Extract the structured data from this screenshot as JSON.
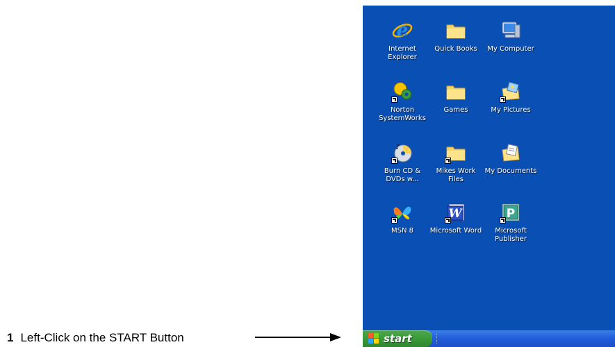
{
  "desktop": {
    "background_color": "#0a4fb3",
    "icons": [
      {
        "label_lines": [
          "Internet",
          "Explorer"
        ],
        "icon": "internet-explorer-icon"
      },
      {
        "label_lines": [
          "Quick Books"
        ],
        "icon": "folder-icon"
      },
      {
        "label_lines": [
          "My Computer"
        ],
        "icon": "my-computer-icon"
      },
      {
        "label_lines": [
          "Norton",
          "SystemWorks"
        ],
        "icon": "norton-systemworks-icon"
      },
      {
        "label_lines": [
          "Games"
        ],
        "icon": "folder-icon"
      },
      {
        "label_lines": [
          "My Pictures"
        ],
        "icon": "my-pictures-icon"
      },
      {
        "label_lines": [
          "Burn CD &",
          "DVDs w..."
        ],
        "icon": "burn-cd-icon"
      },
      {
        "label_lines": [
          "Mikes Work",
          "Files"
        ],
        "icon": "folder-icon"
      },
      {
        "label_lines": [
          "My Documents"
        ],
        "icon": "my-documents-icon"
      },
      {
        "label_lines": [
          "MSN 8"
        ],
        "icon": "msn-butterfly-icon"
      },
      {
        "label_lines": [
          "Microsoft Word"
        ],
        "icon": "word-icon"
      },
      {
        "label_lines": [
          "Microsoft",
          "Publisher"
        ],
        "icon": "publisher-icon"
      }
    ]
  },
  "taskbar": {
    "start_label": "start",
    "start_color": "#3a9a3a",
    "taskbar_color": "#245edc"
  },
  "instruction": {
    "step_number": "1",
    "text": "Left-Click on the START Button"
  }
}
